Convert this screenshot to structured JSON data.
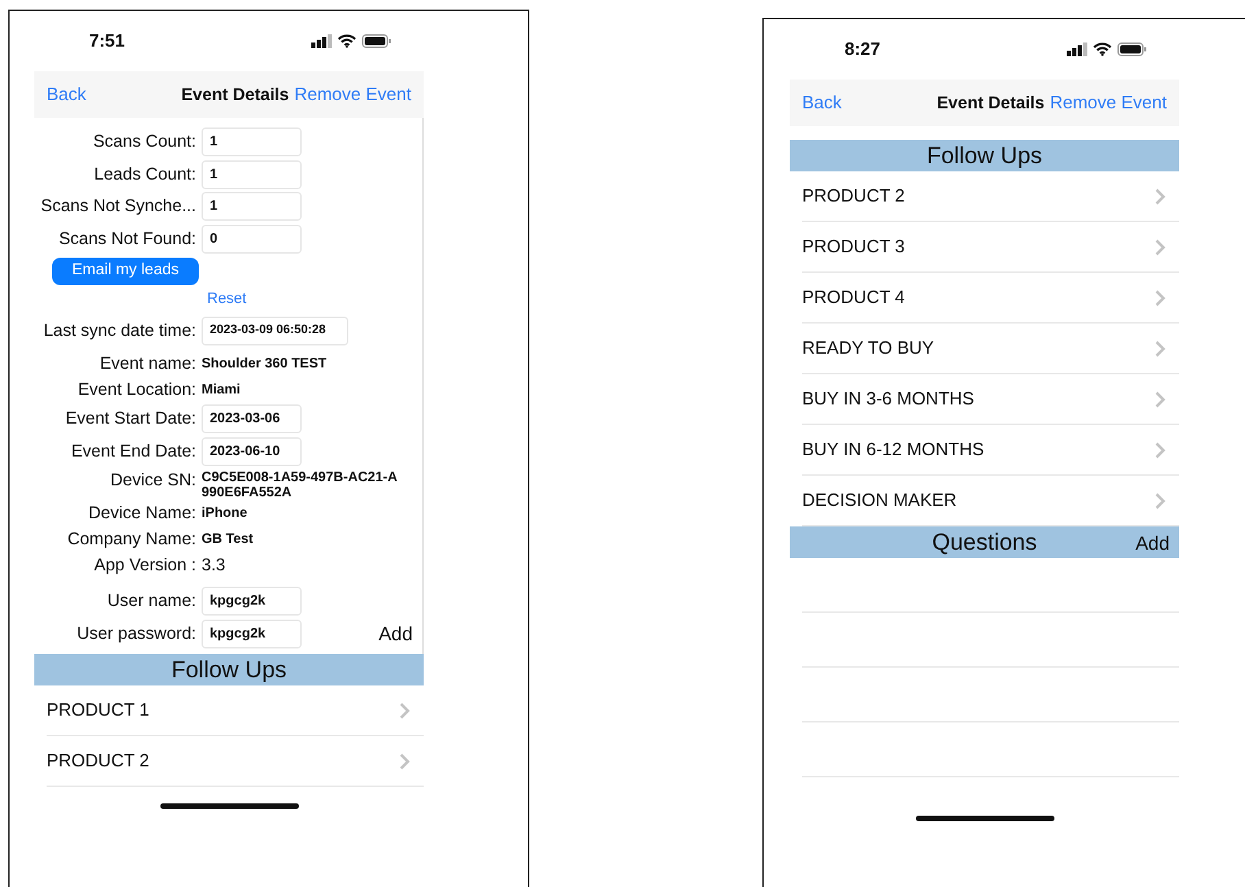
{
  "screens": [
    {
      "status_bar": {
        "time": "7:51"
      },
      "nav_bar": {
        "back": "Back",
        "title": "Event Details",
        "action": "Remove Event"
      },
      "form": [
        {
          "kind": "input",
          "label": "Scans Count:",
          "value": "1"
        },
        {
          "kind": "input",
          "label": "Leads Count:",
          "value": "1"
        },
        {
          "kind": "input",
          "label": "Scans Not Synche...",
          "value": "1"
        },
        {
          "kind": "input",
          "label": "Scans Not Found:",
          "value": "0"
        },
        {
          "kind": "button",
          "label": "Email my leads"
        },
        {
          "kind": "link",
          "label": "Reset"
        },
        {
          "kind": "wide_input",
          "label": "Last sync date time:",
          "value": "2023-03-09 06:50:28"
        },
        {
          "kind": "text",
          "label": "Event name:",
          "value": "Shoulder 360 TEST"
        },
        {
          "kind": "text",
          "label": "Event Location:",
          "value": "Miami"
        },
        {
          "kind": "input",
          "label": "Event Start Date:",
          "value": "2023-03-06"
        },
        {
          "kind": "input",
          "label": "Event End Date:",
          "value": "2023-06-10"
        },
        {
          "kind": "text",
          "label": "Device SN:",
          "value": "C9C5E008-1A59-497B-AC21-A990E6FA552A"
        },
        {
          "kind": "text",
          "label": "Device Name:",
          "value": "iPhone"
        },
        {
          "kind": "text",
          "label": "Company Name:",
          "value": "GB Test"
        },
        {
          "kind": "big_text",
          "label": "App Version :",
          "value": "3.3"
        },
        {
          "kind": "input",
          "label": "User name:",
          "value": "kpgcg2k"
        },
        {
          "kind": "input",
          "label": "User password:",
          "value": "kpgcg2k",
          "action": "Add"
        }
      ],
      "sections": [
        {
          "title": "Follow Ups",
          "items": [
            "PRODUCT 1",
            "PRODUCT 2"
          ]
        }
      ]
    },
    {
      "status_bar": {
        "time": "8:27"
      },
      "nav_bar": {
        "back": "Back",
        "title": "Event Details",
        "action": "Remove Event"
      },
      "sections": [
        {
          "title": "Follow Ups",
          "items": [
            "PRODUCT 2",
            "PRODUCT 3",
            "PRODUCT 4",
            "READY TO BUY",
            "BUY IN 3-6 MONTHS",
            "BUY IN 6-12 MONTHS",
            "DECISION MAKER"
          ]
        },
        {
          "title": "Questions",
          "action": "Add"
        }
      ]
    }
  ]
}
